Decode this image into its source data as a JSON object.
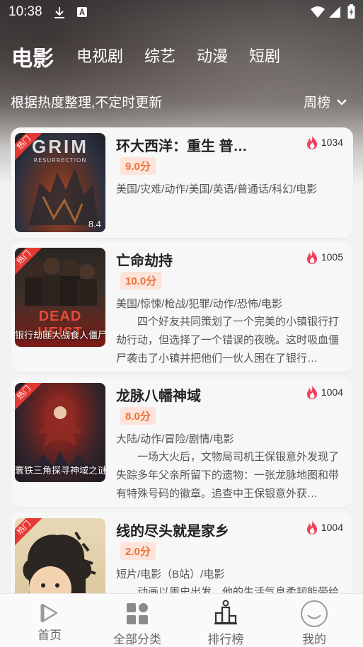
{
  "status_bar": {
    "time": "10:38",
    "icons": [
      "download-icon",
      "text-a-icon",
      "wifi-icon",
      "signal-icon",
      "battery-icon"
    ]
  },
  "tabs": [
    {
      "label": "电影",
      "active": true
    },
    {
      "label": "电视剧",
      "active": false
    },
    {
      "label": "综艺",
      "active": false
    },
    {
      "label": "动漫",
      "active": false
    },
    {
      "label": "短剧",
      "active": false
    }
  ],
  "subheader": {
    "description": "根据热度整理,不定时更新",
    "rank_select": "周榜"
  },
  "items": [
    {
      "title": "环大西洋：重生 普…",
      "heat": "1034",
      "score": "9.0分",
      "tags": "美国/灾难/动作/美国/英语/普通话/科幻/电影",
      "summary": "",
      "hot_tag": "热门",
      "poster_title": "GRIM",
      "poster_subtitle": "RESURRECTION",
      "poster_score": "8.4",
      "poster_caption": ""
    },
    {
      "title": "亡命劫持",
      "heat": "1005",
      "score": "10.0分",
      "tags": "美国/惊悚/枪战/犯罪/动作/恐怖/电影",
      "summary": "四个好友共同策划了一个完美的小镇银行打劫行动，但选择了一个错误的夜晚。这时吸血僵尸袭击了小镇并把他们一伙人困在了银行…",
      "hot_tag": "热门",
      "poster_title": "DEAD HEIST",
      "poster_subtitle": "",
      "poster_score": "",
      "poster_caption": "银行劫匪大战食人僵尸"
    },
    {
      "title": "龙脉八幡神域",
      "heat": "1004",
      "score": "8.0分",
      "tags": "大陆/动作/冒险/剧情/电影",
      "summary": "一场大火后，文物局司机王保银意外发现了失踪多年父亲所留下的遗物：一张龙脉地图和带有特殊号码的徽章。追查中王保银意外获…",
      "hot_tag": "热门",
      "poster_title": "",
      "poster_subtitle": "",
      "poster_score": "",
      "poster_caption": "寰铁三角探寻神域之谜"
    },
    {
      "title": "线的尽头就是家乡",
      "heat": "1004",
      "score": "2.0分",
      "tags": "短片/电影（B站）/电影",
      "summary": "动画以周史出发，他的生活气息柔韧能带给",
      "hot_tag": "热门",
      "poster_title": "",
      "poster_subtitle": "",
      "poster_score": "",
      "poster_caption": ""
    }
  ],
  "bottom_nav": [
    {
      "label": "首页",
      "icon": "play-icon"
    },
    {
      "label": "全部分类",
      "icon": "grid-icon"
    },
    {
      "label": "排行榜",
      "icon": "podium-icon"
    },
    {
      "label": "我的",
      "icon": "smiley-icon"
    }
  ],
  "colors": {
    "accent_fire": "#f23d5b",
    "score_text": "#e8743b",
    "score_bg": "#fde3da",
    "hot_tag": "#e53935"
  }
}
